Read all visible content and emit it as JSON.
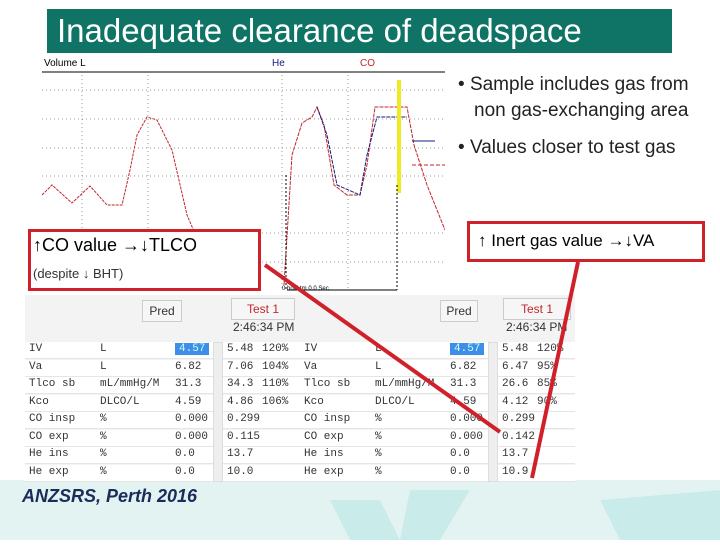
{
  "title": "Inadequate clearance of deadspace",
  "chart": {
    "y_label": "Volume L",
    "legend_he": "He",
    "legend_co": "CO",
    "hold_label": "0 hold tm 0.0 Sec"
  },
  "bullets": [
    "Sample includes gas from non gas-exchanging area",
    "Values closer to test gas"
  ],
  "callout_left": {
    "line1": "↑CO value →↓TLCO",
    "line2": "(despite ↓ BHT)"
  },
  "callout_right": "↑ Inert gas value →↓VA",
  "footer": "ANZSRS, Perth 2016",
  "tables": [
    {
      "pred_label": "Pred",
      "test_label": "Test 1",
      "time": "2:46:34 PM",
      "rows": [
        [
          "IV",
          "L",
          "4.57",
          "5.48",
          "120%"
        ],
        [
          "Va",
          "L",
          "6.82",
          "7.06",
          "104%"
        ],
        [
          "Tlco sb",
          "mL/mmHg/M",
          "31.3",
          "34.3",
          "110%"
        ],
        [
          "Kco",
          "DLCO/L",
          "4.59",
          "4.86",
          "106%"
        ],
        [
          "CO insp",
          "%",
          "0.000",
          "0.299",
          ""
        ],
        [
          "CO exp",
          "%",
          "0.000",
          "0.115",
          ""
        ],
        [
          "He ins",
          "%",
          "0.0",
          "13.7",
          ""
        ],
        [
          "He exp",
          "%",
          "0.0",
          "10.0",
          ""
        ]
      ]
    },
    {
      "pred_label": "Pred",
      "test_label": "Test 1",
      "time": "2:46:34 PM",
      "rows": [
        [
          "IV",
          "L",
          "4.57",
          "5.48",
          "120%"
        ],
        [
          "Va",
          "L",
          "6.82",
          "6.47",
          "95%"
        ],
        [
          "Tlco sb",
          "mL/mmHg/M",
          "31.3",
          "26.6",
          "85%"
        ],
        [
          "Kco",
          "DLCO/L",
          "4.59",
          "4.12",
          "90%"
        ],
        [
          "CO insp",
          "%",
          "0.000",
          "0.299",
          ""
        ],
        [
          "CO exp",
          "%",
          "0.000",
          "0.142",
          ""
        ],
        [
          "He ins",
          "%",
          "0.0",
          "13.7",
          ""
        ],
        [
          "He exp",
          "%",
          "0.0",
          "10.9",
          ""
        ]
      ]
    }
  ],
  "colors": {
    "title_bg": "#0f7466",
    "callout": "#d0202a",
    "co": "#c0282e",
    "he": "#1a1a80"
  }
}
